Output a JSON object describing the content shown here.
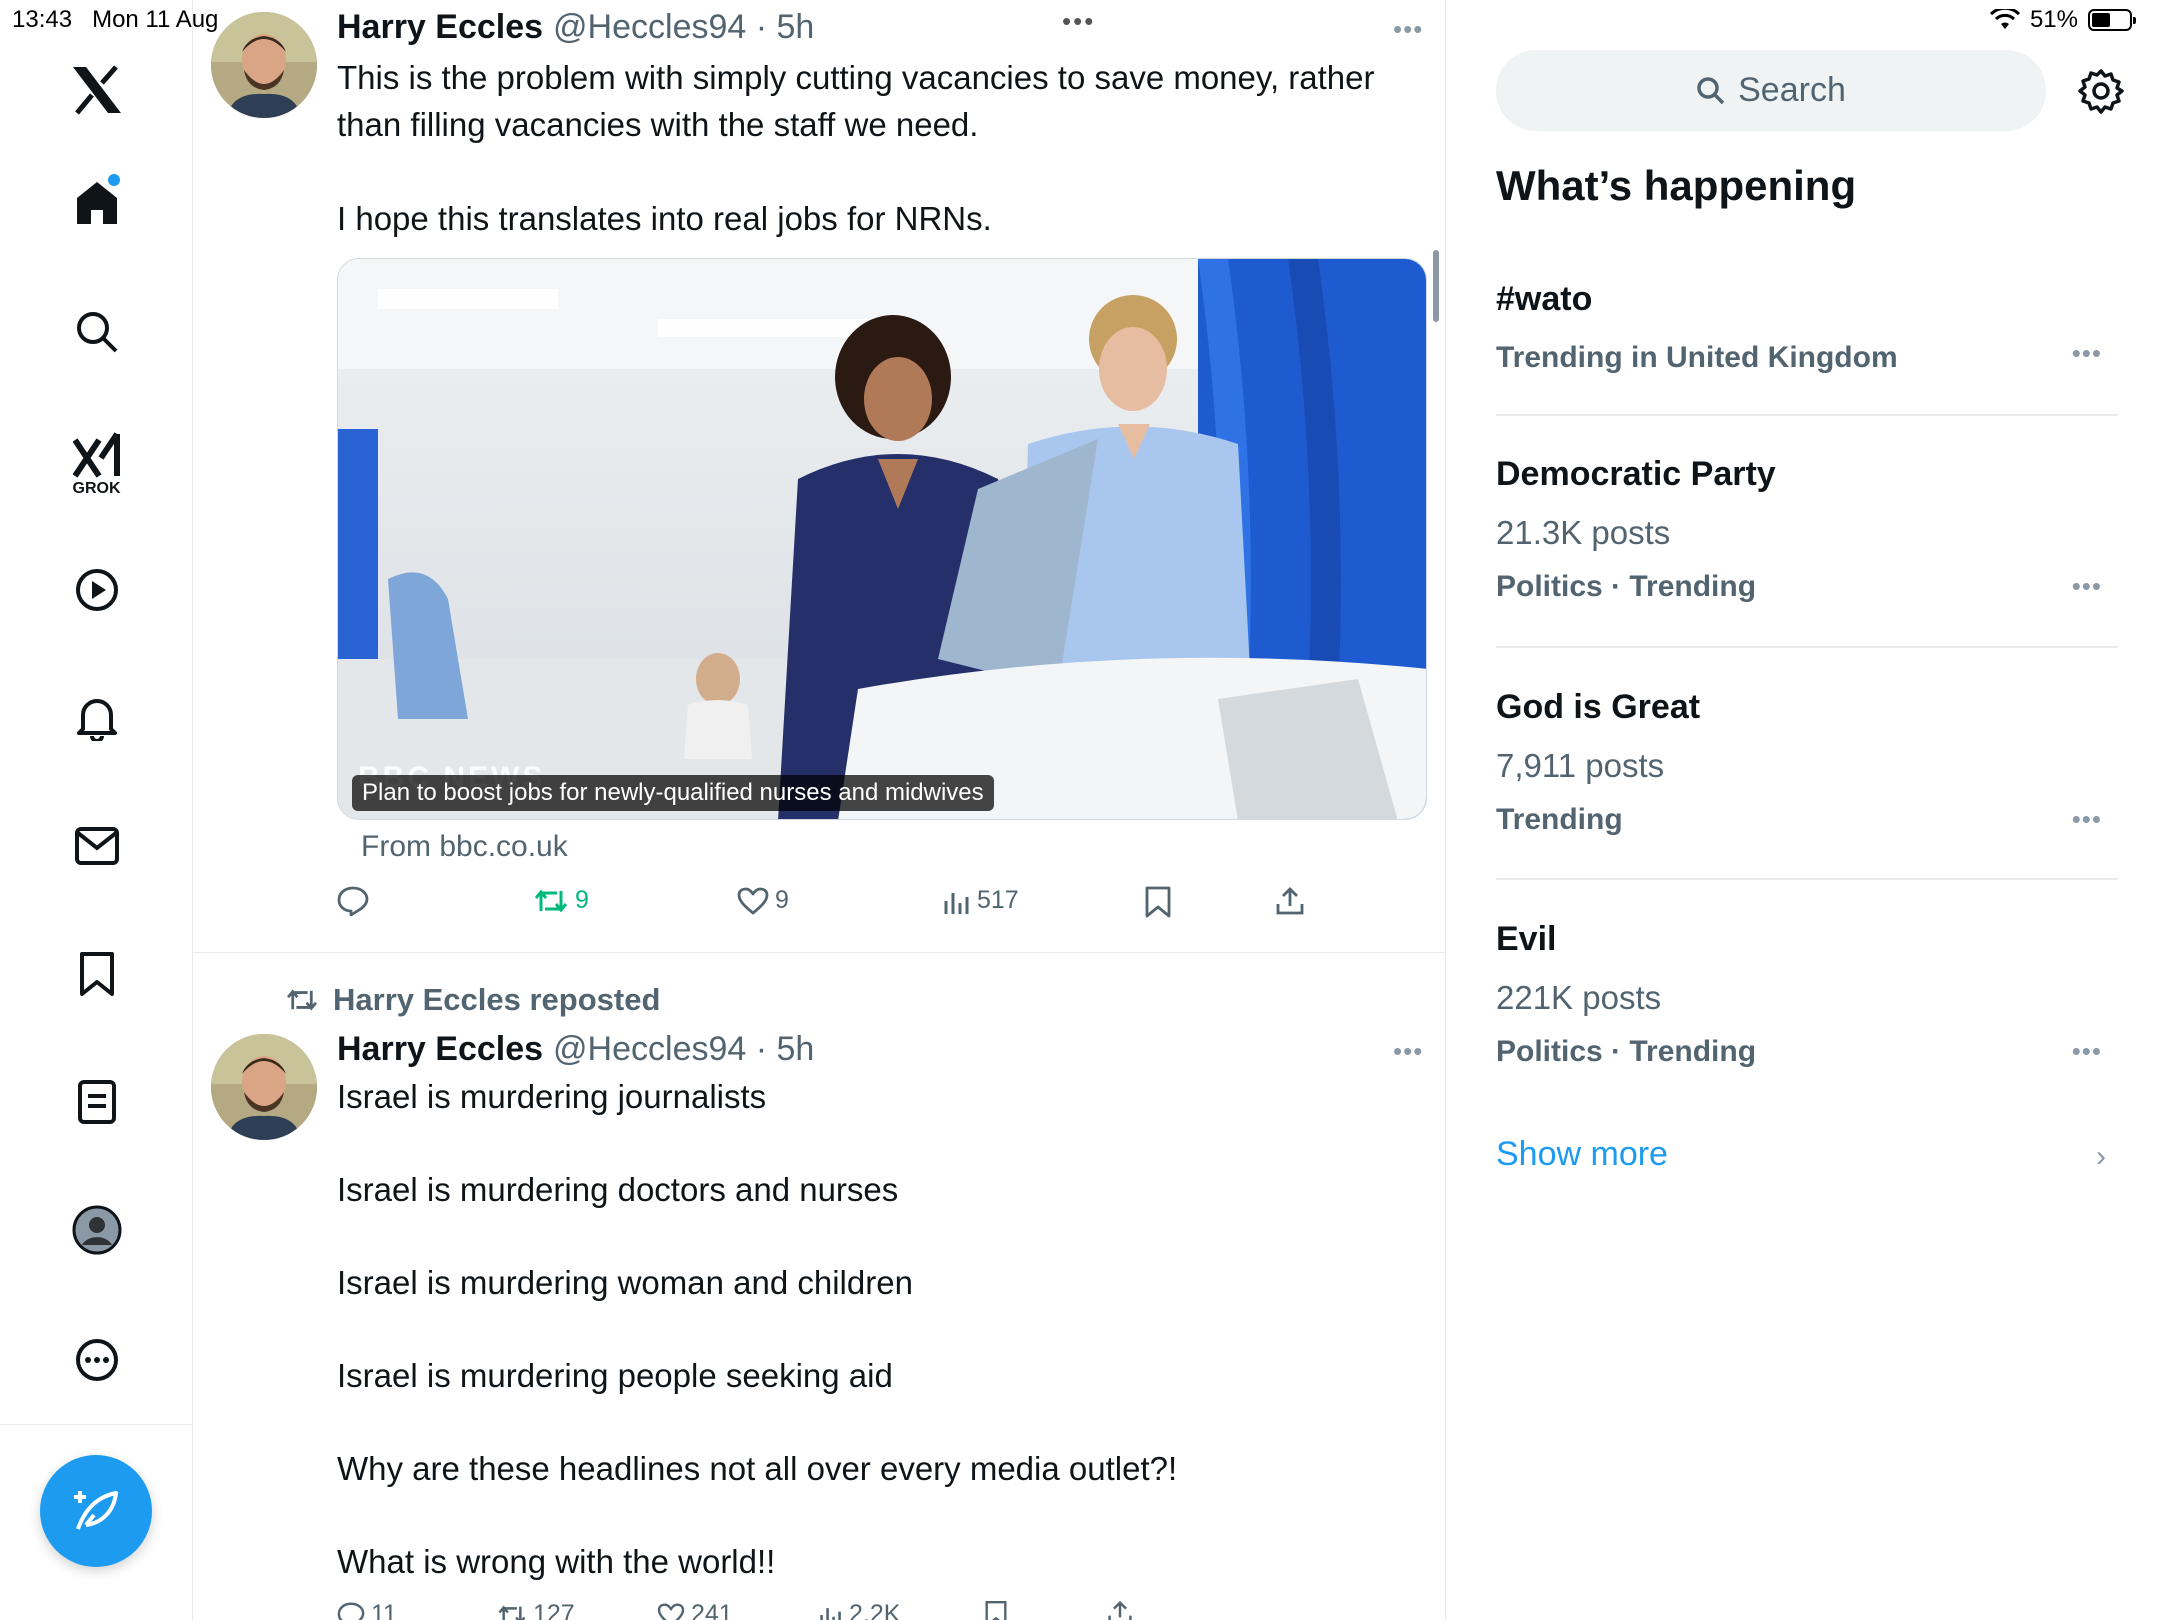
{
  "status_bar": {
    "time": "13:43",
    "date": "Mon 11 Aug",
    "battery": "51%",
    "battery_level": 0.51
  },
  "nav": {
    "items": [
      "x-logo",
      "home-icon",
      "explore-icon",
      "grok-icon",
      "video-icon",
      "notifications-icon",
      "messages-icon",
      "bookmarks-icon",
      "lists-icon",
      "profile-icon",
      "more-icon"
    ],
    "grok_label": "GROK",
    "compose_icon": "compose-icon"
  },
  "colors": {
    "accent": "#1d9bf0",
    "retweet_green": "#00ba7c",
    "muted": "#536471"
  },
  "feed": {
    "tweet1": {
      "name": "Harry Eccles",
      "handle": "@Heccles94 · 5h",
      "lines": [
        "This is the problem with simply cutting vacancies to save money, rather",
        "than filling vacancies with the staff we need.",
        "",
        "I hope this translates into real jobs for NRNs."
      ],
      "card": {
        "caption": "Plan to boost jobs for newly-qualified nurses and midwives",
        "source": "From bbc.co.uk",
        "watermark": "BBC NEWS"
      },
      "actions": {
        "reply": "",
        "retweet": "9",
        "like": "9",
        "views": "517"
      }
    },
    "tweet2": {
      "repost_label": "Harry Eccles reposted",
      "name": "Harry Eccles",
      "handle": "@Heccles94 · 5h",
      "lines": [
        "Israel is murdering journalists",
        "",
        "Israel is murdering doctors and nurses",
        "",
        "Israel is murdering woman and children",
        "",
        "Israel is murdering people seeking aid",
        "",
        "Why are these headlines not all over every media outlet?!",
        "",
        "What is wrong with the world!!"
      ],
      "actions": {
        "reply": "11",
        "retweet": "127",
        "like": "241",
        "views": "2.2K"
      }
    }
  },
  "right": {
    "search_placeholder": "Search",
    "section_title": "What’s happening",
    "trends": [
      {
        "title": "#wato",
        "posts": "",
        "meta": "Trending in United Kingdom"
      },
      {
        "title": "Democratic Party",
        "posts": "21.3K posts",
        "meta": "Politics · Trending"
      },
      {
        "title": "God is Great",
        "posts": "7,911 posts",
        "meta": "Trending"
      },
      {
        "title": "Evil",
        "posts": "221K posts",
        "meta": "Politics · Trending"
      }
    ],
    "show_more": "Show more"
  }
}
